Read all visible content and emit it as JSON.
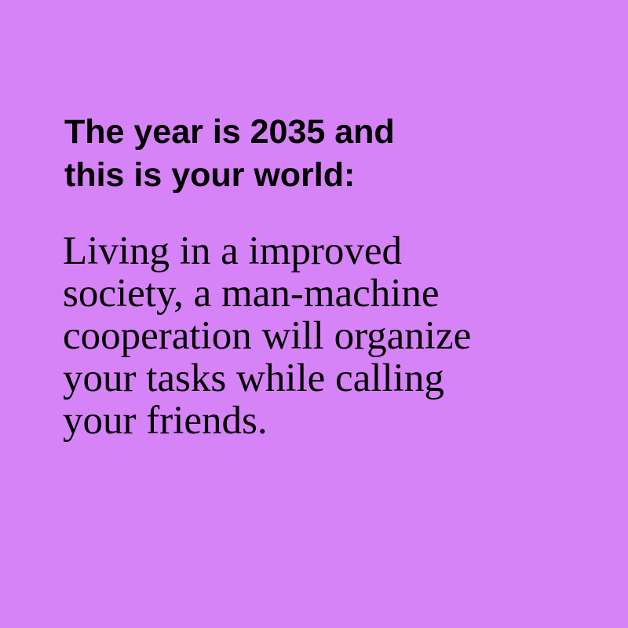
{
  "background_color": "#d683f7",
  "text_color": "#000000",
  "headline": {
    "lines": [
      "The year is 2035 and",
      "this is your world:"
    ]
  },
  "body": {
    "lines": [
      "Living in a improved",
      "society, a man-machine",
      "cooperation will organize",
      "your tasks while calling",
      "your friends."
    ]
  }
}
